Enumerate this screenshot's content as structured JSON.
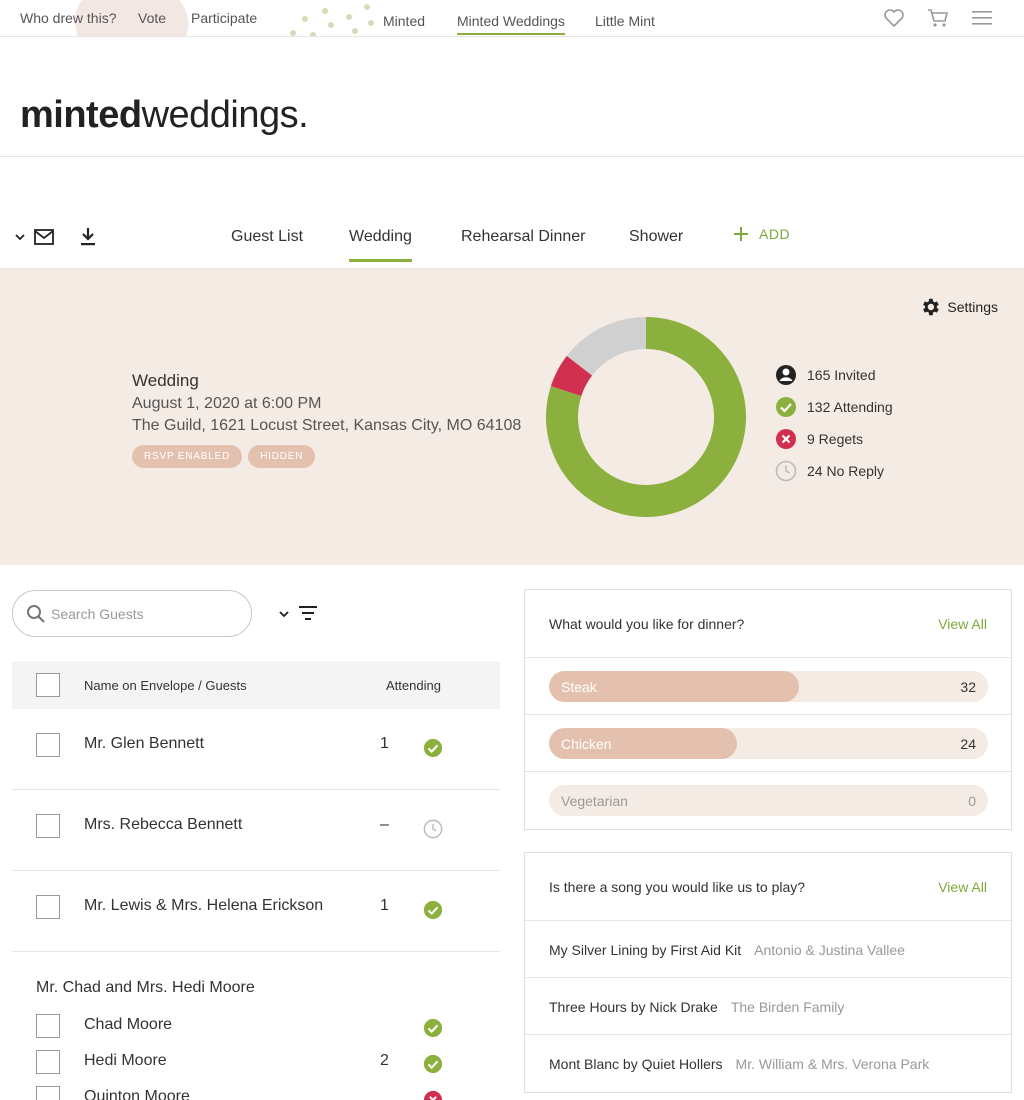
{
  "topnav": {
    "left_links": [
      "Who drew this?",
      "Vote",
      "Participate"
    ],
    "site_links": [
      "Minted",
      "Minted Weddings",
      "Little Mint"
    ],
    "active_site": "Minted Weddings",
    "icons": [
      "heart-icon",
      "cart-icon",
      "menu-icon"
    ]
  },
  "logo": {
    "bold": "minted",
    "light": "weddings."
  },
  "toolbar": {
    "icons": [
      "chevron-down-icon",
      "mail-icon",
      "download-icon"
    ]
  },
  "tabs": [
    {
      "label": "Guest List"
    },
    {
      "label": "Wedding"
    },
    {
      "label": "Rehearsal Dinner"
    },
    {
      "label": "Shower"
    }
  ],
  "active_tab": "Wedding",
  "add_tab_label": "ADD",
  "event": {
    "name": "Wedding",
    "date": "August 1, 2020 at 6:00 PM",
    "address": "The Guild, 1621 Locust Street, Kansas City, MO 64108",
    "badges": [
      "RSVP ENABLED",
      "HIDDEN"
    ]
  },
  "settings_label": "Settings",
  "rsvp_stats": [
    {
      "icon": "person-icon",
      "label": "165 Invited"
    },
    {
      "icon": "check-icon",
      "label": "132 Attending"
    },
    {
      "icon": "x-icon",
      "label": "9 Regets"
    },
    {
      "icon": "clock-icon",
      "label": "24 No Reply"
    }
  ],
  "donut": {
    "segments": [
      {
        "name": "Attending",
        "value": 132,
        "color": "#8cb03e"
      },
      {
        "name": "Regrets",
        "value": 9,
        "color": "#d12f4f"
      },
      {
        "name": "No Reply",
        "value": 24,
        "color": "#d0d0d0"
      }
    ]
  },
  "colors": {
    "accent": "#8cb03e",
    "decline": "#d12f4f",
    "pending": "#cccccc",
    "panel_bg": "#f5ebe5",
    "bar": "#e4c1ae"
  },
  "search": {
    "placeholder": "Search Guests",
    "value": ""
  },
  "table": {
    "headers": {
      "name": "Name on Envelope / Guests",
      "attending": "Attending"
    },
    "rows": [
      {
        "name": "Mr. Glen Bennett",
        "count": "1",
        "status": "check-icon"
      },
      {
        "name": "Mrs. Rebecca Bennett",
        "count": "–",
        "status": "clock-icon"
      },
      {
        "name": "Mr. Lewis & Mrs. Helena Erickson",
        "count": "1",
        "status": "check-icon"
      }
    ],
    "group": {
      "title": "Mr. Chad and Mrs. Hedi Moore",
      "members": [
        {
          "name": "Chad Moore",
          "count": "",
          "status": "check-icon"
        },
        {
          "name": "Hedi Moore",
          "count": "2",
          "status": "check-icon"
        },
        {
          "name": "Quinton Moore",
          "count": "",
          "status": "x-icon"
        }
      ]
    }
  },
  "dinner": {
    "question": "What would you like for dinner?",
    "view_all": "View All",
    "max": 32,
    "options": [
      {
        "label": "Steak",
        "count": 32
      },
      {
        "label": "Chicken",
        "count": 24
      },
      {
        "label": "Vegetarian",
        "count": 0
      }
    ]
  },
  "song": {
    "question": "Is there a song you would like us to play?",
    "view_all": "View All",
    "answers": [
      {
        "song": "My Silver Lining by First Aid Kit",
        "by": "Antonio & Justina Vallee"
      },
      {
        "song": "Three Hours by Nick Drake",
        "by": "The Birden Family"
      },
      {
        "song": "Mont Blanc by Quiet Hollers",
        "by": "Mr. William & Mrs. Verona Park"
      }
    ]
  }
}
